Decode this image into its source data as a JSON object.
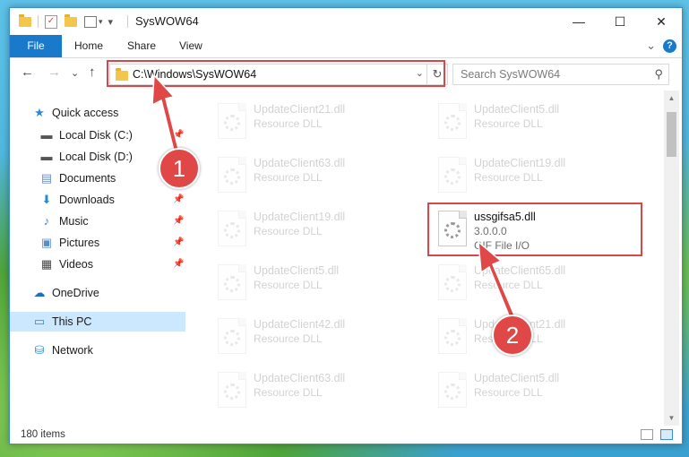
{
  "window": {
    "title": "SysWOW64",
    "controls": {
      "minimize": "—",
      "maximize": "☐",
      "close": "✕"
    }
  },
  "ribbon": {
    "tabs": [
      "File",
      "Home",
      "Share",
      "View"
    ],
    "expand_glyph": "⌄",
    "help_glyph": "?"
  },
  "navigation": {
    "back_glyph": "←",
    "forward_glyph": "→",
    "recent_glyph": "⌄",
    "up_glyph": "↑",
    "address": "C:\\Windows\\SysWOW64",
    "address_dropdown_glyph": "⌄",
    "refresh_glyph": "↻",
    "search_placeholder": "Search SysWOW64",
    "search_glyph": "⚲"
  },
  "sidebar": {
    "items": [
      {
        "label": "Quick access",
        "icon": "star-icon",
        "glyph": "★",
        "color": "#2b88d8",
        "pinned": false
      },
      {
        "label": "Local Disk (C:)",
        "icon": "drive-icon",
        "glyph": "▬",
        "color": "#555555",
        "pinned": true
      },
      {
        "label": "Local Disk (D:)",
        "icon": "drive-icon",
        "glyph": "▬",
        "color": "#555555",
        "pinned": true
      },
      {
        "label": "Documents",
        "icon": "documents-icon",
        "glyph": "▤",
        "color": "#6c8ebf",
        "pinned": true
      },
      {
        "label": "Downloads",
        "icon": "downloads-icon",
        "glyph": "⬇",
        "color": "#2b88d8",
        "pinned": true
      },
      {
        "label": "Music",
        "icon": "music-icon",
        "glyph": "♪",
        "color": "#2b88d8",
        "pinned": true
      },
      {
        "label": "Pictures",
        "icon": "pictures-icon",
        "glyph": "▣",
        "color": "#5a8dc7",
        "pinned": true
      },
      {
        "label": "Videos",
        "icon": "videos-icon",
        "glyph": "▦",
        "color": "#444444",
        "pinned": true
      },
      {
        "label": "OneDrive",
        "icon": "onedrive-icon",
        "glyph": "☁",
        "color": "#1e6fc4",
        "pinned": false
      },
      {
        "label": "This PC",
        "icon": "this-pc-icon",
        "glyph": "▭",
        "color": "#2b88d8",
        "pinned": false
      },
      {
        "label": "Network",
        "icon": "network-icon",
        "glyph": "⛁",
        "color": "#2b88d8",
        "pinned": false
      }
    ],
    "pin_glyph": "📌"
  },
  "files": [
    {
      "name": "UpdateClient21.dll",
      "type": "Resource DLL"
    },
    {
      "name": "UpdateClient5.dll",
      "type": "Resource DLL"
    },
    {
      "name": "UpdateClient63.dll",
      "type": "Resource DLL"
    },
    {
      "name": "UpdateClient19.dll",
      "type": "Resource DLL"
    },
    {
      "name": "UpdateClient19.dll",
      "type": "Resource DLL"
    },
    {
      "name": "ussgifsa5.dll",
      "version": "3.0.0.0",
      "type": "GIF File I/O"
    },
    {
      "name": "UpdateClient5.dll",
      "type": "Resource DLL"
    },
    {
      "name": "UpdateClient65.dll",
      "type": "Resource DLL"
    },
    {
      "name": "UpdateClient42.dll",
      "type": "Resource DLL"
    },
    {
      "name": "UpdateClient21.dll",
      "type": "Resource DLL"
    },
    {
      "name": "UpdateClient63.dll",
      "type": "Resource DLL"
    },
    {
      "name": "UpdateClient5.dll",
      "type": "Resource DLL"
    }
  ],
  "scrollbar": {
    "up_glyph": "▲",
    "down_glyph": "▼"
  },
  "status": {
    "item_count": "180 items"
  },
  "callouts": {
    "step1": "1",
    "step2": "2",
    "color": "#e04848"
  }
}
